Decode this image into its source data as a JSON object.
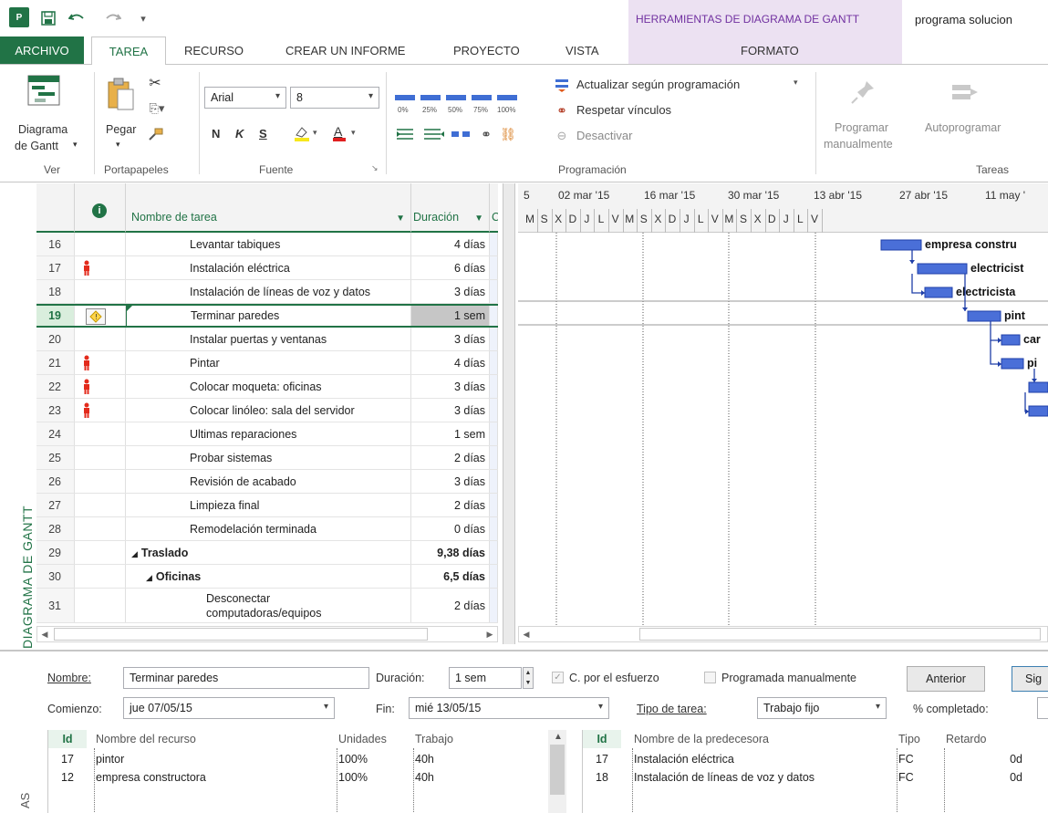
{
  "app": {
    "logo_text": "P",
    "context_tab_title": "HERRAMIENTAS DE DIAGRAMA DE GANTT",
    "window_title": "programa solucion"
  },
  "tabs": {
    "archivo": "ARCHIVO",
    "tarea": "TAREA",
    "recurso": "RECURSO",
    "crear_informe": "CREAR UN INFORME",
    "proyecto": "PROYECTO",
    "vista": "VISTA",
    "formato": "FORMATO"
  },
  "ribbon": {
    "ver": {
      "button_line1": "Diagrama",
      "button_line2": "de Gantt",
      "label": "Ver"
    },
    "portapapeles": {
      "pegar": "Pegar",
      "label": "Portapapeles"
    },
    "fuente": {
      "font_name": "Arial",
      "font_size": "8",
      "bold": "N",
      "italic": "K",
      "underline": "S",
      "label": "Fuente"
    },
    "programacion": {
      "percent_labels": [
        "0%",
        "25%",
        "50%",
        "75%",
        "100%"
      ],
      "actualizar": "Actualizar según programación",
      "respetar": "Respetar vínculos",
      "desactivar": "Desactivar",
      "label": "Programación"
    },
    "tareas": {
      "programar_line1": "Programar",
      "programar_line2": "manualmente",
      "autoprogramar": "Autoprogramar",
      "label": "Tareas"
    }
  },
  "view_bar": {
    "label": "DIAGRAMA DE GANTT"
  },
  "table": {
    "headers": {
      "name": "Nombre de tarea",
      "duration": "Duración",
      "extra": "C"
    },
    "rows": [
      {
        "id": "16",
        "name": "Levantar tabiques",
        "duration": "4 días",
        "indent": 2,
        "bold": false,
        "person": false
      },
      {
        "id": "17",
        "name": "Instalación eléctrica",
        "duration": "6 días",
        "indent": 2,
        "bold": false,
        "person": true
      },
      {
        "id": "18",
        "name": "Instalación de líneas de voz y datos",
        "duration": "3 días",
        "indent": 2,
        "bold": false,
        "person": false
      },
      {
        "id": "19",
        "name": "Terminar paredes",
        "duration": "1 sem",
        "indent": 2,
        "bold": false,
        "person": false,
        "selected": true,
        "warning": true
      },
      {
        "id": "20",
        "name": "Instalar puertas y ventanas",
        "duration": "3 días",
        "indent": 2,
        "bold": false,
        "person": false
      },
      {
        "id": "21",
        "name": "Pintar",
        "duration": "4 días",
        "indent": 2,
        "bold": false,
        "person": true
      },
      {
        "id": "22",
        "name": "Colocar moqueta: oficinas",
        "duration": "3 días",
        "indent": 2,
        "bold": false,
        "person": true
      },
      {
        "id": "23",
        "name": "Colocar linóleo: sala del servidor",
        "duration": "3 días",
        "indent": 2,
        "bold": false,
        "person": true
      },
      {
        "id": "24",
        "name": "Ultimas reparaciones",
        "duration": "1 sem",
        "indent": 2,
        "bold": false,
        "person": false
      },
      {
        "id": "25",
        "name": "Probar sistemas",
        "duration": "2 días",
        "indent": 2,
        "bold": false,
        "person": false
      },
      {
        "id": "26",
        "name": "Revisión de acabado",
        "duration": "3 días",
        "indent": 2,
        "bold": false,
        "person": false
      },
      {
        "id": "27",
        "name": "Limpieza final",
        "duration": "2 días",
        "indent": 2,
        "bold": false,
        "person": false
      },
      {
        "id": "28",
        "name": "Remodelación terminada",
        "duration": "0 días",
        "indent": 2,
        "bold": false,
        "person": false
      },
      {
        "id": "29",
        "name": "Traslado",
        "duration": "9,38 días",
        "indent": 0,
        "bold": true,
        "person": false,
        "summary": true
      },
      {
        "id": "30",
        "name": "Oficinas",
        "duration": "6,5 días",
        "indent": 1,
        "bold": true,
        "person": false,
        "summary": true
      },
      {
        "id": "31",
        "name": "Desconectar",
        "name2": "computadoras/equipos",
        "duration": "2 días",
        "indent": 3,
        "bold": false,
        "person": false,
        "tall": true
      }
    ]
  },
  "gantt": {
    "prev_label": "5",
    "dates": [
      "02 mar '15",
      "16 mar '15",
      "30 mar '15",
      "13 abr '15",
      "27 abr '15",
      "11 may '"
    ],
    "days": [
      "M",
      "S",
      "X",
      "D",
      "J",
      "L",
      "V",
      "M",
      "S",
      "X",
      "D",
      "J",
      "L",
      "V",
      "M",
      "S",
      "X",
      "D",
      "J",
      "L",
      "V"
    ],
    "bar_labels": {
      "r16": "empresa constru",
      "r17": "electricist",
      "r18": "electricista",
      "r19": "pint",
      "r20": "car",
      "r21": "pi"
    },
    "bar_color": "#4a6fd8"
  },
  "form": {
    "nombre_label": "Nombre:",
    "nombre_value": "Terminar paredes",
    "duracion_label": "Duración:",
    "duracion_value": "1 sem",
    "esfuerzo_label": "C. por el esfuerzo",
    "manual_label": "Programada manualmente",
    "anterior": "Anterior",
    "siguiente": "Sig",
    "comienzo_label": "Comienzo:",
    "comienzo_value": "jue 07/05/15",
    "fin_label": "Fin:",
    "fin_value": "mié 13/05/15",
    "tipo_label": "Tipo de tarea:",
    "tipo_value": "Trabajo fijo",
    "completado_label": "% completado:",
    "resources": {
      "headers": [
        "Id",
        "Nombre del recurso",
        "Unidades",
        "Trabajo"
      ],
      "rows": [
        [
          "17",
          "pintor",
          "100%",
          "40h"
        ],
        [
          "12",
          "empresa constructora",
          "100%",
          "40h"
        ]
      ]
    },
    "predecessors": {
      "headers": [
        "Id",
        "Nombre de la predecesora",
        "Tipo",
        "Retardo"
      ],
      "rows": [
        [
          "17",
          "Instalación eléctrica",
          "FC",
          "0d"
        ],
        [
          "18",
          "Instalación de líneas de voz y datos",
          "FC",
          "0d"
        ]
      ]
    },
    "side_label": "AS"
  }
}
